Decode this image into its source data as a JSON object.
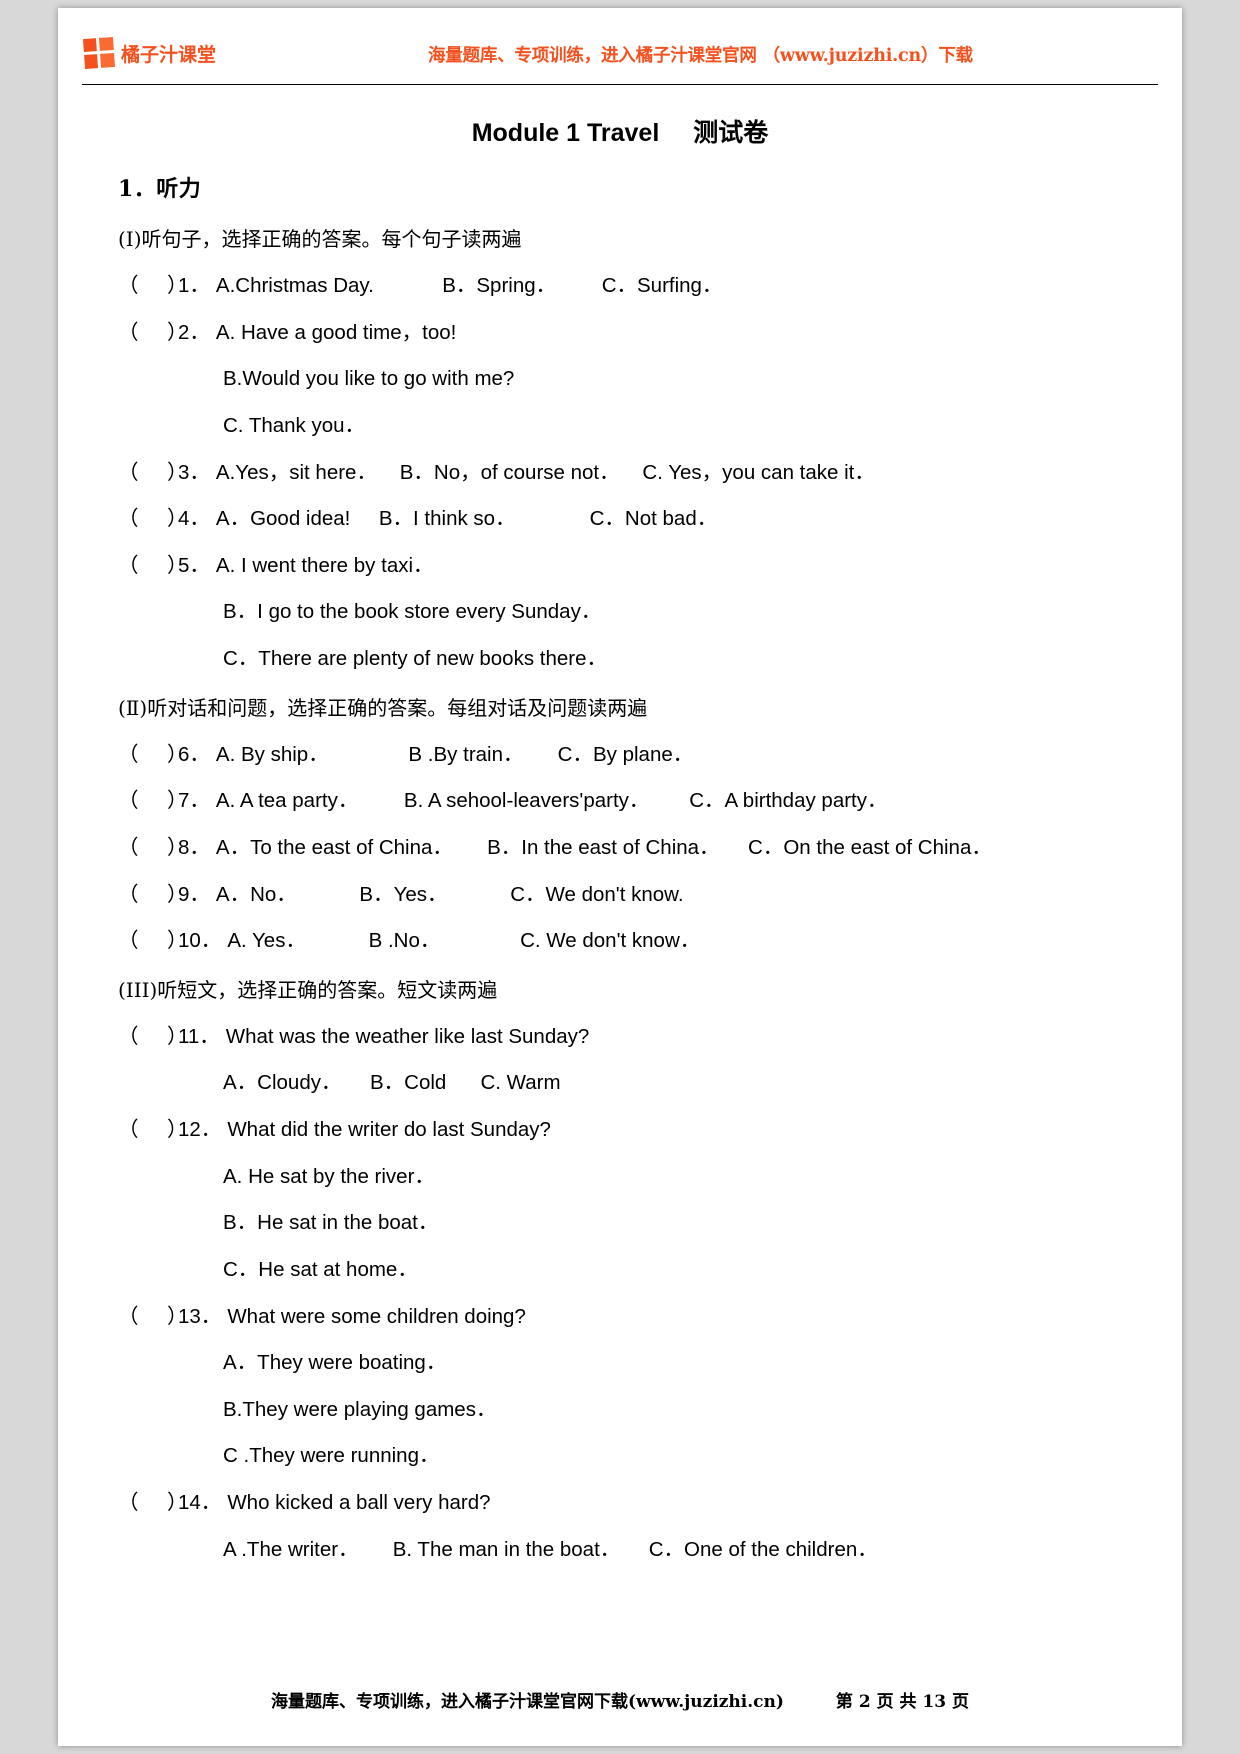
{
  "header": {
    "logo_name": "橘子汁课堂",
    "promo": "海量题库、专项训练，进入橘子汁课堂官网 （www.juzizhi.cn）下载",
    "brand_color": "#f4511e"
  },
  "title": {
    "en": "Module 1 Travel",
    "cn": "测试卷"
  },
  "section": {
    "number_label": "1．听力",
    "part1_head": "(I)听句子，选择正确的答案。每个句子读两遍",
    "part2_head": "(Ⅱ)听对话和问题，选择正确的答案。每组对话及问题读两遍",
    "part3_head": "(III)听短文，选择正确的答案。短文读两遍"
  },
  "bracket": "（     ）",
  "questions": [
    {
      "num": "1．",
      "inline": "A.Christmas Day.            B．Spring．        C．Surfing．",
      "lines": []
    },
    {
      "num": "2．",
      "inline": "A. Have a good time，too!",
      "lines": [
        "B.Would you like to go with me?",
        "C. Thank you．"
      ]
    },
    {
      "num": "3．",
      "inline": "A.Yes，sit here．    B．No，of course not．    C. Yes，you can take it．",
      "lines": []
    },
    {
      "num": "4．",
      "inline": "A．Good idea!     B．I think so．             C．Not bad．",
      "lines": []
    },
    {
      "num": "5．",
      "inline": "A. I went there by taxi．",
      "lines": [
        "B．I go to the book store every Sunday．",
        "C．There are plenty of new books there．"
      ]
    },
    {
      "num": "6．",
      "inline": "A. By ship．              B .By train．      C．By plane．",
      "lines": []
    },
    {
      "num": "7．",
      "inline": "A. A tea party．        B. A sehool-leavers'party．       C．A birthday party．",
      "lines": []
    },
    {
      "num": "8．",
      "inline": "A．To the east of China．      B．In the east of China．     C．On the east of China．",
      "lines": []
    },
    {
      "num": "9．",
      "inline": "A．No．           B．Yes．           C．We don't know.",
      "lines": []
    },
    {
      "num": "10．",
      "inline": "A. Yes．           B .No．              C. We don't know．",
      "lines": []
    },
    {
      "num": "11．",
      "inline": "What was the weather like last Sunday?",
      "lines": [
        "A．Cloudy．     B．Cold      C. Warm"
      ]
    },
    {
      "num": "12．",
      "inline": "What did the writer do last Sunday?",
      "lines": [
        "A. He sat by the river．",
        "B．He sat in the boat．",
        "C．He sat at home．"
      ]
    },
    {
      "num": "13．",
      "inline": "What were some children doing?",
      "lines": [
        "A．They were boating．",
        "B.They were playing games．",
        "C .They were running．"
      ]
    },
    {
      "num": "14．",
      "inline": "Who kicked a ball very hard?",
      "lines": [
        "A .The writer．      B. The man in the boat．     C．One of the children．"
      ]
    }
  ],
  "footer": {
    "promo": "海量题库、专项训练，进入橘子汁课堂官网下载(www.juzizhi.cn)",
    "page": "第 2 页 共 13 页"
  }
}
